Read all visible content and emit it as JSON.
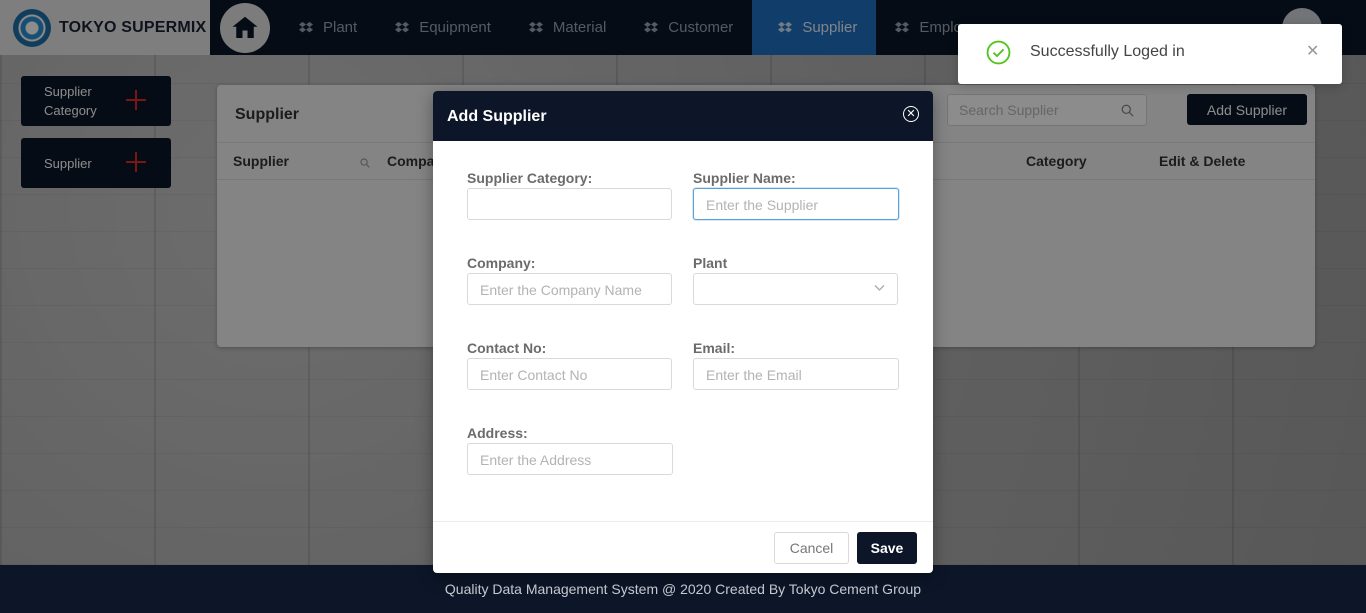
{
  "brand": {
    "name": "TOKYO SUPERMIX"
  },
  "nav": {
    "items": [
      {
        "label": "Plant",
        "icon": "dropbox-icon"
      },
      {
        "label": "Equipment",
        "icon": "dropbox-icon"
      },
      {
        "label": "Material",
        "icon": "dropbox-icon"
      },
      {
        "label": "Customer",
        "icon": "dropbox-icon"
      },
      {
        "label": "Supplier",
        "icon": "dropbox-icon",
        "active": true
      },
      {
        "label": "Emplo",
        "icon": "dropbox-icon"
      }
    ],
    "active_color": "#1e6fc0"
  },
  "sidebar": {
    "buttons": [
      {
        "label": "Supplier Category"
      },
      {
        "label": "Supplier"
      }
    ]
  },
  "panel": {
    "title": "Supplier",
    "search_placeholder": "Search Supplier",
    "add_button": "Add Supplier",
    "columns": [
      "Supplier",
      "Compa",
      "Category",
      "Edit & Delete"
    ]
  },
  "modal": {
    "title": "Add Supplier",
    "fields": {
      "supplier_category": {
        "label": "Supplier Category:",
        "placeholder": ""
      },
      "supplier_name": {
        "label": "Supplier Name:",
        "placeholder": "Enter the Supplier"
      },
      "company": {
        "label": "Company:",
        "placeholder": "Enter the Company Name"
      },
      "plant": {
        "label": "Plant",
        "placeholder": ""
      },
      "contact_no": {
        "label": "Contact No:",
        "placeholder": "Enter Contact No"
      },
      "email": {
        "label": "Email:",
        "placeholder": "Enter the Email"
      },
      "address": {
        "label": "Address:",
        "placeholder": "Enter the Address"
      }
    },
    "cancel": "Cancel",
    "save": "Save"
  },
  "toast": {
    "message": "Successfully Loged in",
    "color": "#52c41a"
  },
  "footer": {
    "text": "Quality Data Management System @ 2020 Created By Tokyo Cement Group"
  },
  "colors": {
    "navy": "#0c1628",
    "accent": "#e02828"
  }
}
